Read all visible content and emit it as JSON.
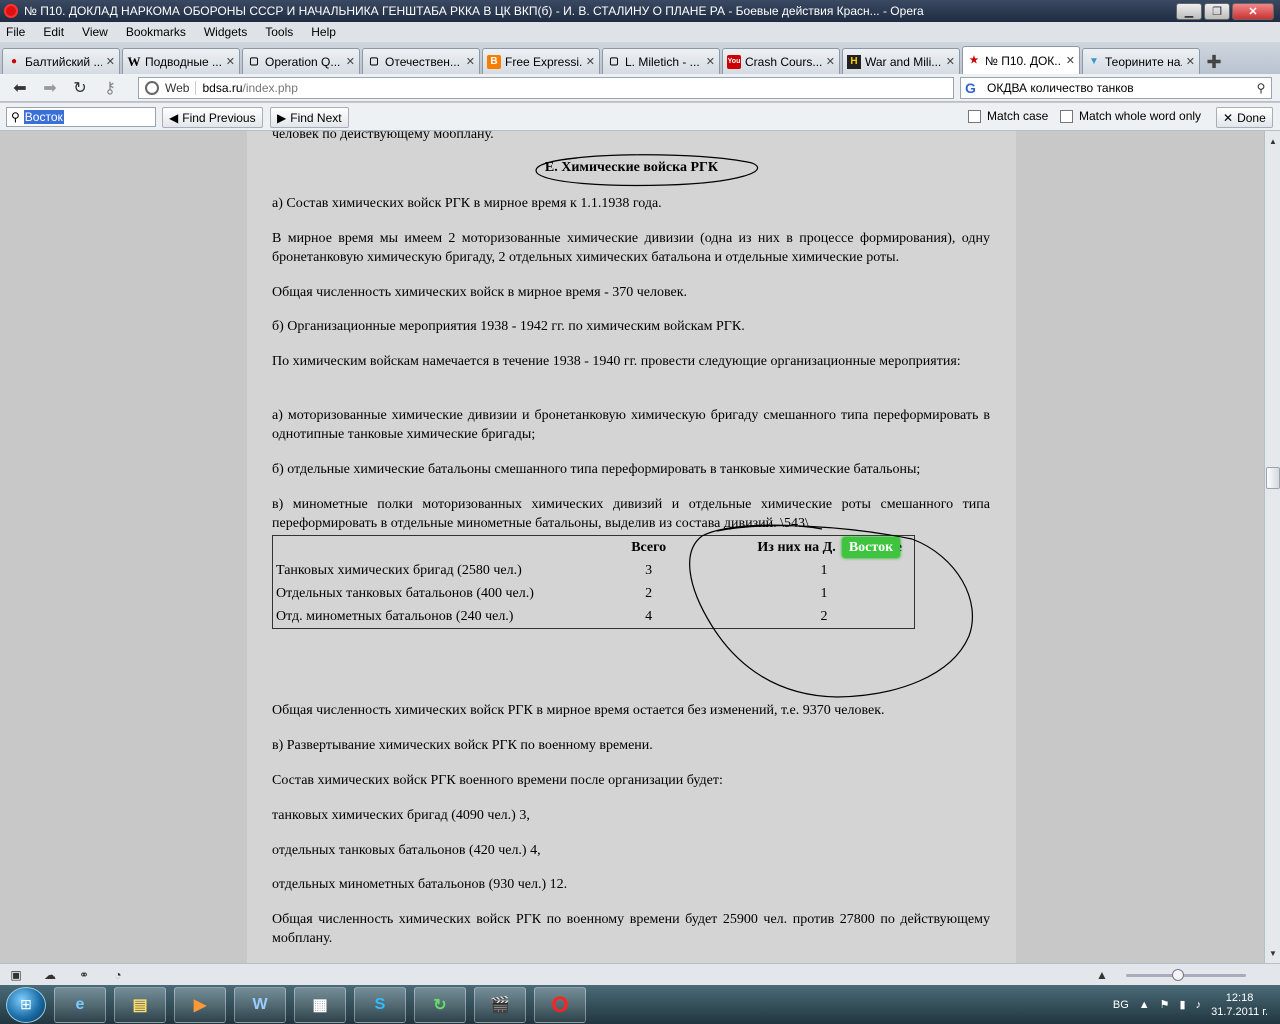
{
  "window": {
    "title": "№ П10. ДОКЛАД НАРКОМА ОБОРОНЫ СССР И НАЧАЛЬНИКА ГЕНШТАБА РККА В ЦК ВКП(б) - И. В. СТАЛИНУ О ПЛАНЕ РА - Боевые действия Красн... - Opera"
  },
  "menu": [
    "File",
    "Edit",
    "View",
    "Bookmarks",
    "Widgets",
    "Tools",
    "Help"
  ],
  "tabs": [
    {
      "label": "Балтийский ...",
      "icon": "opera-page-icon"
    },
    {
      "label": "Подводные ...",
      "icon": "wikipedia-icon"
    },
    {
      "label": "Operation Q...",
      "icon": "page-icon"
    },
    {
      "label": "Отечествен...",
      "icon": "page-icon"
    },
    {
      "label": "Free Expressi...",
      "icon": "blogger-icon"
    },
    {
      "label": "L. Miletich - ...",
      "icon": "page-icon"
    },
    {
      "label": "Crash Cours...",
      "icon": "youtube-icon"
    },
    {
      "label": "War and Mili...",
      "icon": "history-icon"
    },
    {
      "label": "№ П10. ДОК...",
      "icon": "star-icon",
      "active": true
    },
    {
      "label": "Теорините на...",
      "icon": "page-icon"
    }
  ],
  "address": {
    "web_label": "Web",
    "domain": "bdsa.ru",
    "path": "/index.php"
  },
  "search": {
    "value": "ОКДВА количество танков"
  },
  "findbar": {
    "query": "Восток",
    "prev": "Find Previous",
    "next": "Find Next",
    "match_case": "Match case",
    "whole_word": "Match whole word only",
    "done": "Done"
  },
  "doc": {
    "cut_top": "человек по действующему мобплану.",
    "heading": "Е. Химические войска РГК",
    "p1": "а) Состав химических войск РГК в мирное время к 1.1.1938 года.",
    "p2": "В мирное время мы имеем 2 моторизованные химические дивизии (одна из них в процессе формирования), одну бронетанковую химическую бригаду, 2 отдельных химических батальона и отдельные химические роты.",
    "p3": "Общая численность химических войск в мирное время - 370 человек.",
    "p4": "б) Организационные мероприятия 1938 - 1942 гг. по химическим войскам РГК.",
    "p5": "По химическим войскам намечается в течение 1938 - 1940 гг. провести следующие организационные мероприятия:",
    "p6": "а) моторизованные химические дивизии и бронетанковую химическую бригаду смешанного типа переформировать в однотипные танковые химические бригады;",
    "p7": "б) отдельные химические батальоны смешанного типа переформировать в танковые химические батальоны;",
    "p8": "в) минометные полки моторизованных химических дивизий и отдельные химические роты смешанного типа переформировать в отдельные минометные батальоны, выделив из состава дивизий. \\543\\",
    "table": {
      "headers": [
        "",
        "Всего",
        "Из них на Д.",
        "е"
      ],
      "rows": [
        [
          "Танковых химических бригад (2580 чел.)",
          "3",
          "1"
        ],
        [
          "Отдельных танковых батальонов (400 чел.)",
          "2",
          "1"
        ],
        [
          "Отд. минометных батальонов (240 чел.)",
          "4",
          "2"
        ]
      ]
    },
    "find_highlight": "Восток",
    "p9": "Общая численность химических войск РГК в мирное время остается без изменений, т.е. 9370 человек.",
    "p10": "в) Развертывание химических войск РГК по военному времени.",
    "p11": "Состав химических войск РГК военного времени после организации будет:",
    "p12": "танковых химических бригад (4090 чел.) 3,",
    "p13": "отдельных танковых батальонов (420 чел.) 4,",
    "p14": "отдельных минометных батальонов (930 чел.) 12.",
    "p15": "Общая численность химических войск РГК по военному времени будет 25900 чел. против 27800 по действующему мобплану."
  },
  "tray": {
    "lang": "BG",
    "time": "12:18",
    "date": "31.7.2011 г."
  }
}
